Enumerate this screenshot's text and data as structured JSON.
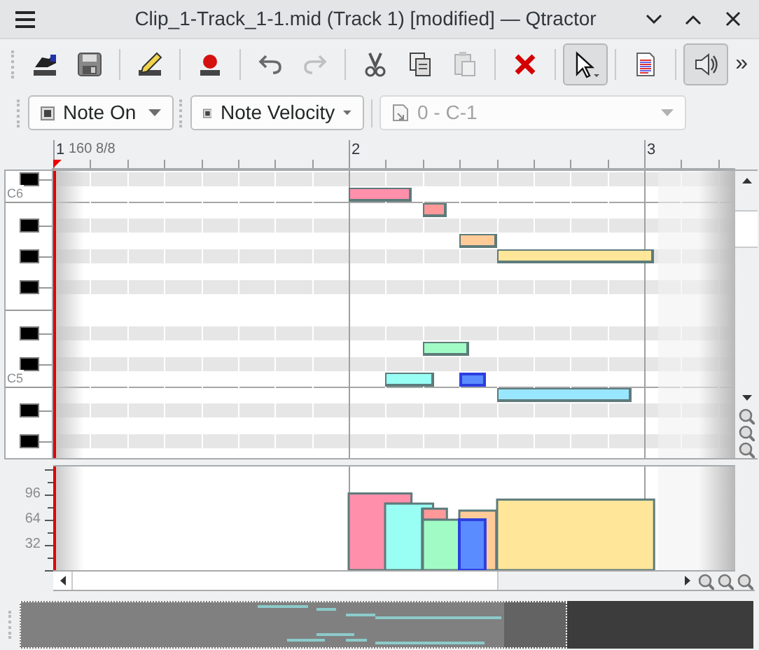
{
  "window": {
    "title": "Clip_1-Track_1-1.mid (Track 1) [modified] — Qtractor"
  },
  "toolbar": {
    "groups": [
      [
        {
          "kind": "properties",
          "pressed": false,
          "disabled": false
        },
        {
          "kind": "save",
          "pressed": false,
          "disabled": false
        }
      ],
      [
        {
          "kind": "edit",
          "pressed": false,
          "disabled": false
        }
      ],
      [
        {
          "kind": "record",
          "pressed": false,
          "disabled": false
        }
      ],
      [
        {
          "kind": "undo",
          "pressed": false,
          "disabled": false
        },
        {
          "kind": "redo",
          "pressed": false,
          "disabled": true
        }
      ],
      [
        {
          "kind": "cut",
          "pressed": false,
          "disabled": false
        },
        {
          "kind": "copy",
          "pressed": false,
          "disabled": false
        },
        {
          "kind": "paste",
          "pressed": false,
          "disabled": true
        }
      ],
      [
        {
          "kind": "delete",
          "pressed": false,
          "disabled": false
        }
      ],
      [
        {
          "kind": "select",
          "pressed": true,
          "disabled": false
        }
      ],
      [
        {
          "kind": "view",
          "pressed": false,
          "disabled": false
        }
      ],
      [
        {
          "kind": "speaker",
          "pressed": true,
          "disabled": false
        }
      ]
    ],
    "overflow": "»"
  },
  "selectors": [
    {
      "kind": "square",
      "value": "Note On",
      "disabled": false
    },
    {
      "kind": "square",
      "value": "Note Velocity",
      "disabled": false
    },
    {
      "kind": "file",
      "value": "0 - C-1",
      "disabled": true
    }
  ],
  "ruler": {
    "bars": [
      {
        "label": "1",
        "detail": "160 8/8"
      },
      {
        "label": "2"
      },
      {
        "label": "3"
      }
    ]
  },
  "keyboard": {
    "labels": [
      "C6",
      "C5"
    ]
  },
  "velocity_axis": {
    "labels": [
      "96",
      "64",
      "32"
    ]
  },
  "notes": [
    {
      "level": 0.76,
      "color": "#ff8fab",
      "selected": false
    },
    {
      "level": 0.66,
      "color": "#99fff5",
      "selected": false
    },
    {
      "level": 0.61,
      "color": "#ff9999",
      "selected": false
    },
    {
      "level": 0.5,
      "color": "#a0fcc4",
      "selected": false
    },
    {
      "level": 0.59,
      "color": "#ffcc99",
      "selected": false
    },
    {
      "level": 0.5,
      "color": "#5b8cff",
      "selected": true
    },
    {
      "color": "#99e6ff",
      "selected": false
    },
    {
      "level": 0.7,
      "color": "#ffe699",
      "selected": false
    }
  ]
}
